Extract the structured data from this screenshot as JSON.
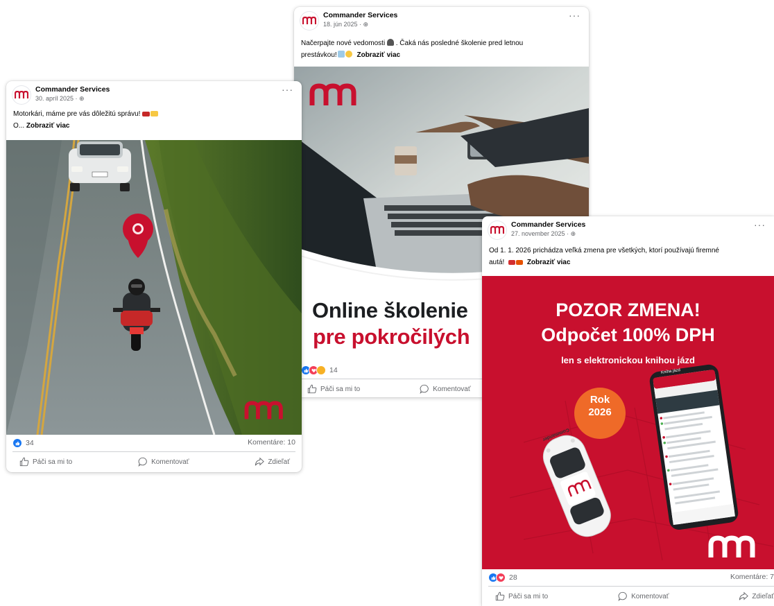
{
  "brand": {
    "primary_color": "#c8102e",
    "logo_text": "mm"
  },
  "posts": [
    {
      "page_name": "Commander Services",
      "date": "30. apríl 2025",
      "privacy_icon": "globe-icon",
      "text_line1": "Motorkári, máme pre vás dôležitú správu!",
      "text_line2_prefix": "O...",
      "see_more": "Zobraziť viac",
      "media": "road-motorcycle-location-pin-photo",
      "reaction_count": "34",
      "comments": "Komentáre: 10",
      "actions": {
        "like": "Páči sa mi to",
        "comment": "Komentovať",
        "share": "Zdieľať"
      }
    },
    {
      "page_name": "Commander Services",
      "date": "18. jún 2025",
      "privacy_icon": "globe-icon",
      "text_line1": "Načerpajte nové vedomosti",
      "text_line1_suffix": ". Čaká nás posledné školenie pred letnou",
      "text_line2": "prestávkou!",
      "see_more": "Zobraziť viac",
      "media": "laptop-typing-photo",
      "headline_1": "Online školenie",
      "headline_2": "pre pokročilých",
      "reaction_count": "14",
      "actions": {
        "like": "Páči sa mi to",
        "comment": "Komentovať"
      }
    },
    {
      "page_name": "Commander Services",
      "date": "27. november 2025",
      "privacy_icon": "globe-icon",
      "text_line1": "Od 1. 1. 2026 prichádza veľká zmena pre všetkých, ktorí používajú firemné",
      "text_line2": "autá!",
      "see_more": "Zobraziť viac",
      "media": "car-and-phone-app-graphic",
      "headline_1": "POZOR ZMENA!",
      "headline_2": "Odpočet 100% DPH",
      "subheadline": "len s elektronickou knihou jázd",
      "badge_line1": "Rok",
      "badge_line2": "2026",
      "phone_title": "Kniha jázd",
      "car_brand": "Commander",
      "reaction_count": "28",
      "comments": "Komentáre: 7",
      "actions": {
        "like": "Páči sa mi to",
        "comment": "Komentovať",
        "share": "Zdieľať"
      }
    }
  ]
}
